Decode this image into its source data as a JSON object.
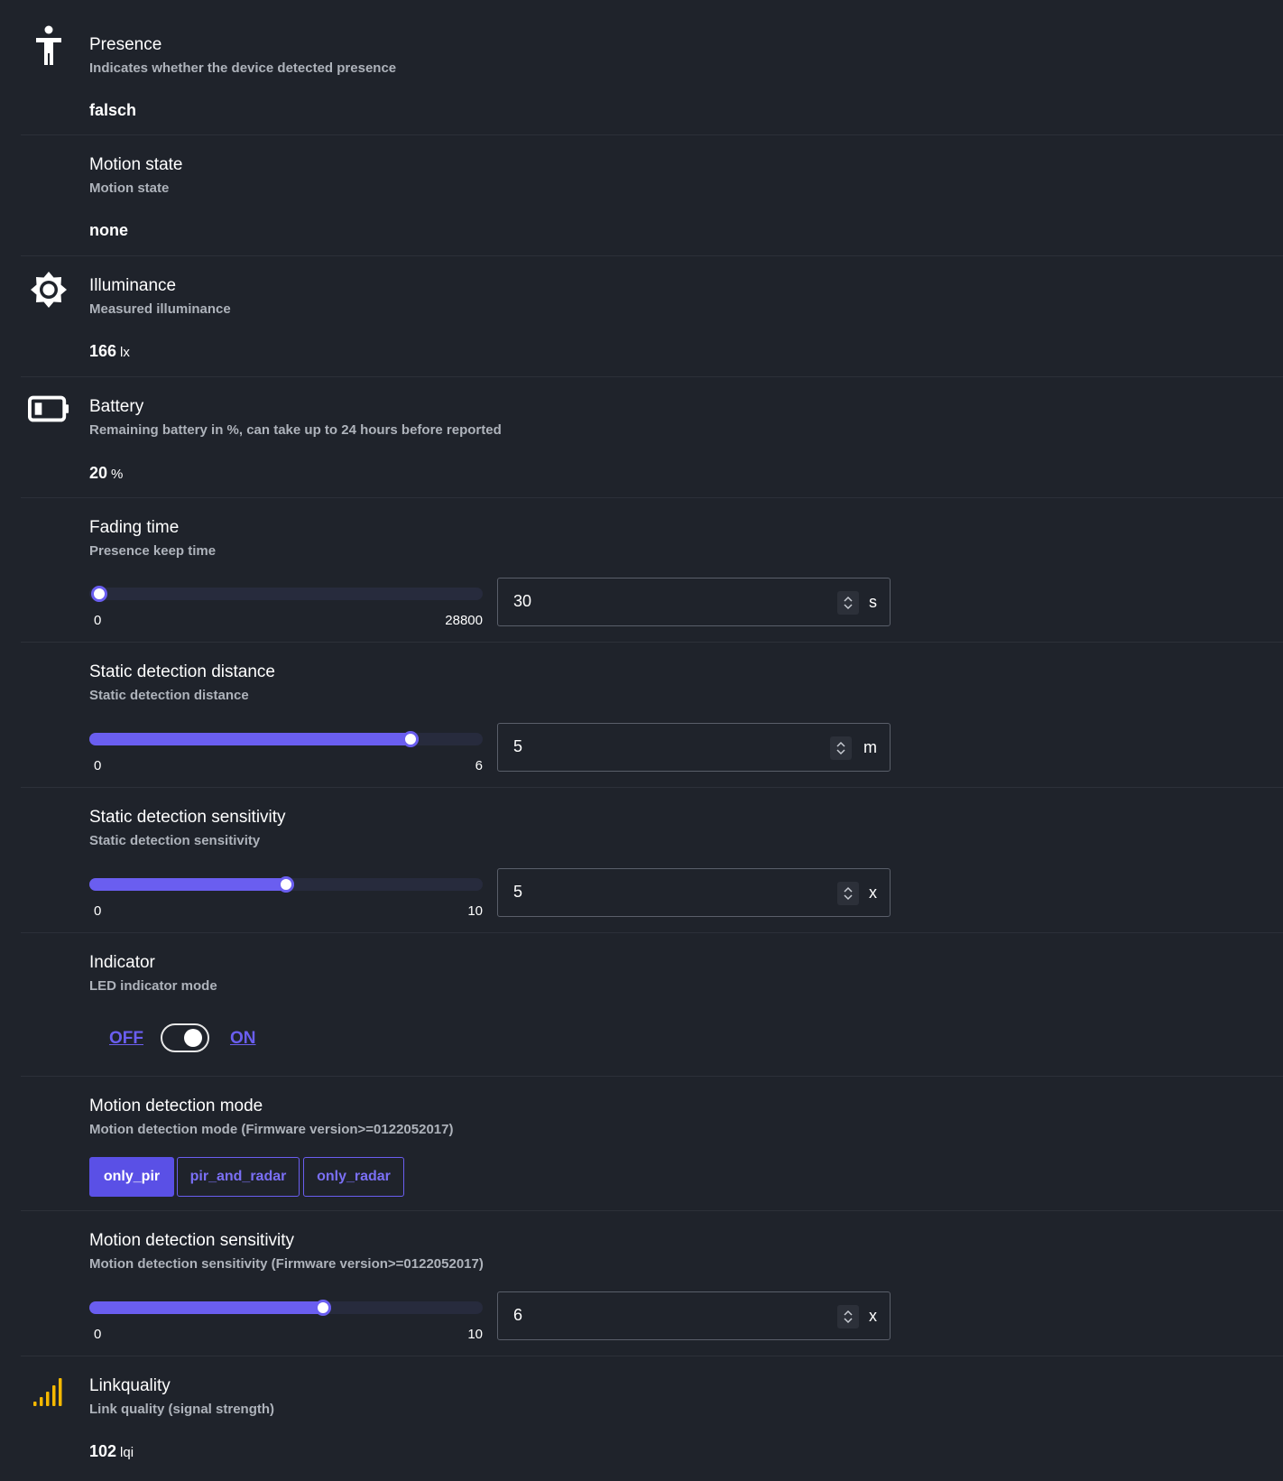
{
  "colors": {
    "background": "#1f232b",
    "accent": "#6a5ef0",
    "signal": "#f5b800",
    "muted_text": "#aeb3bb"
  },
  "presence": {
    "icon": "person-icon",
    "title": "Presence",
    "description": "Indicates whether the device detected presence",
    "value": "falsch"
  },
  "motion_state": {
    "title": "Motion state",
    "description": "Motion state",
    "value": "none"
  },
  "illuminance": {
    "icon": "brightness-icon",
    "title": "Illuminance",
    "description": "Measured illuminance",
    "value": "166",
    "unit": "lx"
  },
  "battery": {
    "icon": "battery-icon",
    "title": "Battery",
    "description": "Remaining battery in %, can take up to 24 hours before reported",
    "value": "20",
    "unit": "%"
  },
  "fading_time": {
    "title": "Fading time",
    "description": "Presence keep time",
    "min": "0",
    "max": "28800",
    "value": "30",
    "unit": "s",
    "slider_fraction": 0.001
  },
  "static_distance": {
    "title": "Static detection distance",
    "description": "Static detection distance",
    "min": "0",
    "max": "6",
    "value": "5",
    "unit": "m",
    "slider_fraction": 0.8333
  },
  "static_sensitivity": {
    "title": "Static detection sensitivity",
    "description": "Static detection sensitivity",
    "min": "0",
    "max": "10",
    "value": "5",
    "unit": "x",
    "slider_fraction": 0.5
  },
  "indicator": {
    "title": "Indicator",
    "description": "LED indicator mode",
    "off_label": "OFF",
    "on_label": "ON",
    "state": "ON"
  },
  "motion_mode": {
    "title": "Motion detection mode",
    "description": "Motion detection mode (Firmware version>=0122052017)",
    "options": [
      "only_pir",
      "pir_and_radar",
      "only_radar"
    ],
    "selected": "only_pir"
  },
  "motion_sensitivity": {
    "title": "Motion detection sensitivity",
    "description": "Motion detection sensitivity (Firmware version>=0122052017)",
    "min": "0",
    "max": "10",
    "value": "6",
    "unit": "x",
    "slider_fraction": 0.6
  },
  "linkquality": {
    "icon": "signal-icon",
    "title": "Linkquality",
    "description": "Link quality (signal strength)",
    "value": "102",
    "unit": "lqi"
  }
}
